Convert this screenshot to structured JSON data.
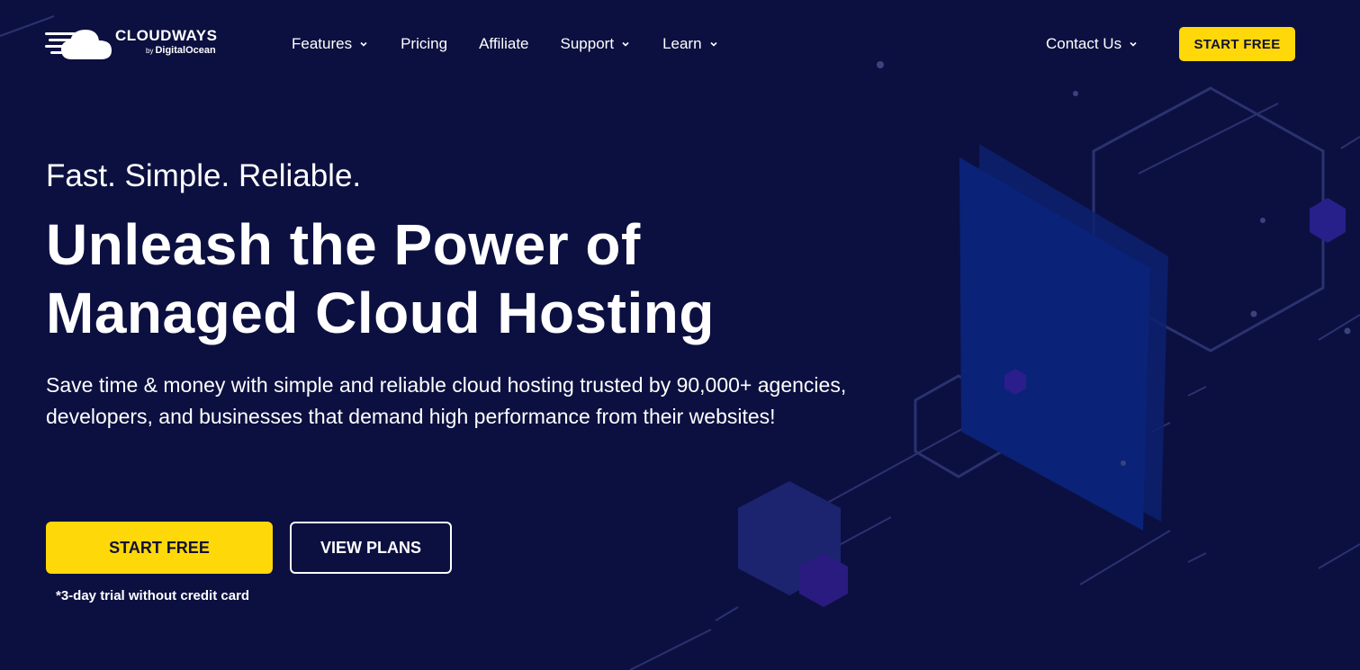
{
  "brand": {
    "name": "CLOUDWAYS",
    "by": "by",
    "parent": "DigitalOcean"
  },
  "nav": {
    "items": [
      {
        "label": "Features",
        "has_dropdown": true
      },
      {
        "label": "Pricing",
        "has_dropdown": false
      },
      {
        "label": "Affiliate",
        "has_dropdown": false
      },
      {
        "label": "Support",
        "has_dropdown": true
      },
      {
        "label": "Learn",
        "has_dropdown": true
      }
    ],
    "contact_label": "Contact Us",
    "start_free_label": "START FREE"
  },
  "hero": {
    "tagline": "Fast. Simple. Reliable.",
    "headline_line1": "Unleash the Power of",
    "headline_line2": "Managed Cloud Hosting",
    "description": "Save time & money with simple and reliable cloud hosting trusted by 90,000+ agencies, developers, and businesses that demand high performance from their websites!",
    "primary_cta": "START FREE",
    "secondary_cta": "VIEW PLANS",
    "trial_note": "*3-day trial without credit card"
  },
  "colors": {
    "background": "#0c1040",
    "accent": "#ffd80a",
    "text": "#ffffff",
    "button_text": "#111133"
  },
  "icons": [
    "cloudways-logo-icon",
    "chevron-down-icon"
  ]
}
